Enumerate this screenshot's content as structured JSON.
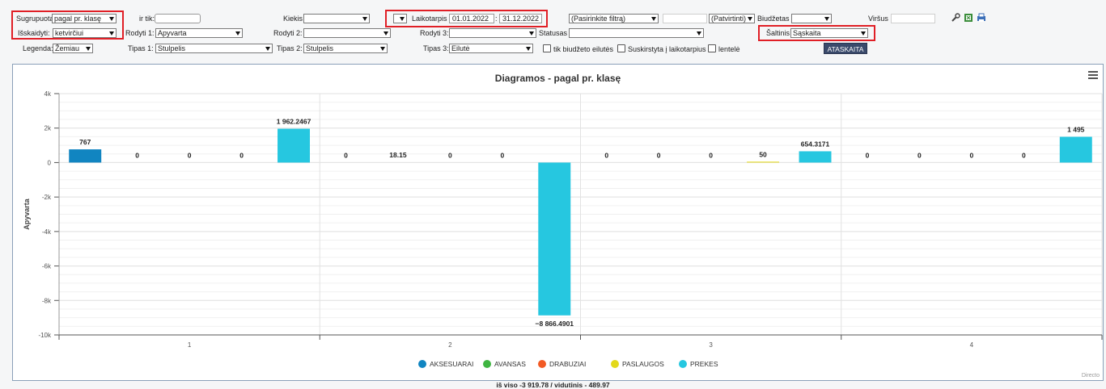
{
  "toolbar": {
    "group_label": "Sugrupuota",
    "group_value": "pagal pr. klasę",
    "irtik_label": "ir tik:",
    "split_label": "Išskaidyti:",
    "split_value": "ketvirčiui",
    "legend_label": "Legenda:",
    "legend_value": "Žemiau",
    "show1_label": "Rodyti 1:",
    "show1_value": "Apyvarta",
    "type1_label": "Tipas 1:",
    "type1_value": "Stulpelis",
    "qty_label": "Kiekis",
    "show2_label": "Rodyti 2:",
    "type2_label": "Tipas 2:",
    "type2_value": "Stulpelis",
    "period_label": "Laikotarpis",
    "period_from": "01.01.2022",
    "period_to": "31.12.2022",
    "show3_label": "Rodyti 3:",
    "type3_label": "Tipas 3:",
    "type3_value": "Eilutė",
    "status_label": "Statusas",
    "filter_value": "(Pasirinkite filtrą)",
    "confirmed_value": "(Patvirtinti)",
    "budget_label": "Biudžetas",
    "source_label": "Šaltinis",
    "source_value": "Sąskaita",
    "top_label": "Viršus",
    "chk_budget_label": "tik biudžeto eilutės",
    "chk_split_label": "Suskirstyta į laikotarpius",
    "chk_table_label": "lentelė",
    "report_button": "ATASKAITA"
  },
  "chart_data": {
    "type": "bar",
    "title": "Diagramos - pagal pr. klasę",
    "ylabel": "Apyvarta",
    "xlabel": "",
    "ylim": [
      -10000,
      4000
    ],
    "yticks": [
      4000,
      2000,
      0,
      -2000,
      -4000,
      -6000,
      -8000,
      -10000
    ],
    "ytick_labels": [
      "4k",
      "2k",
      "0",
      "-2k",
      "-4k",
      "-6k",
      "-8k",
      "-10k"
    ],
    "categories": [
      "1",
      "2",
      "3",
      "4"
    ],
    "legend_position": "bottom",
    "series": [
      {
        "name": "AKSESUARAI",
        "color": "#1185c1",
        "values": [
          767,
          0,
          0,
          0
        ],
        "labels": [
          "767",
          "0",
          "0",
          "0"
        ]
      },
      {
        "name": "AVANSAS",
        "color": "#3fb541",
        "values": [
          0,
          18.15,
          0,
          0
        ],
        "labels": [
          "0",
          "18.15",
          "0",
          "0"
        ]
      },
      {
        "name": "DRABUZIAI",
        "color": "#f25a24",
        "values": [
          0,
          0,
          0,
          0
        ],
        "labels": [
          "0",
          "0",
          "0",
          "0"
        ]
      },
      {
        "name": "PASLAUGOS",
        "color": "#e3d91b",
        "values": [
          0,
          0,
          50,
          0
        ],
        "labels": [
          "0",
          "0",
          "50",
          "0"
        ]
      },
      {
        "name": "PREKES",
        "color": "#26c7e0",
        "values": [
          1962.2467,
          -8866.4901,
          654.3171,
          1495
        ],
        "labels": [
          "1 962.2467",
          "−8 866.4901",
          "654.3171",
          "1 495"
        ]
      }
    ],
    "credits": "Directo"
  },
  "footer": {
    "summary": "iš viso -3 919.78 / vidutinis - 489.97"
  }
}
